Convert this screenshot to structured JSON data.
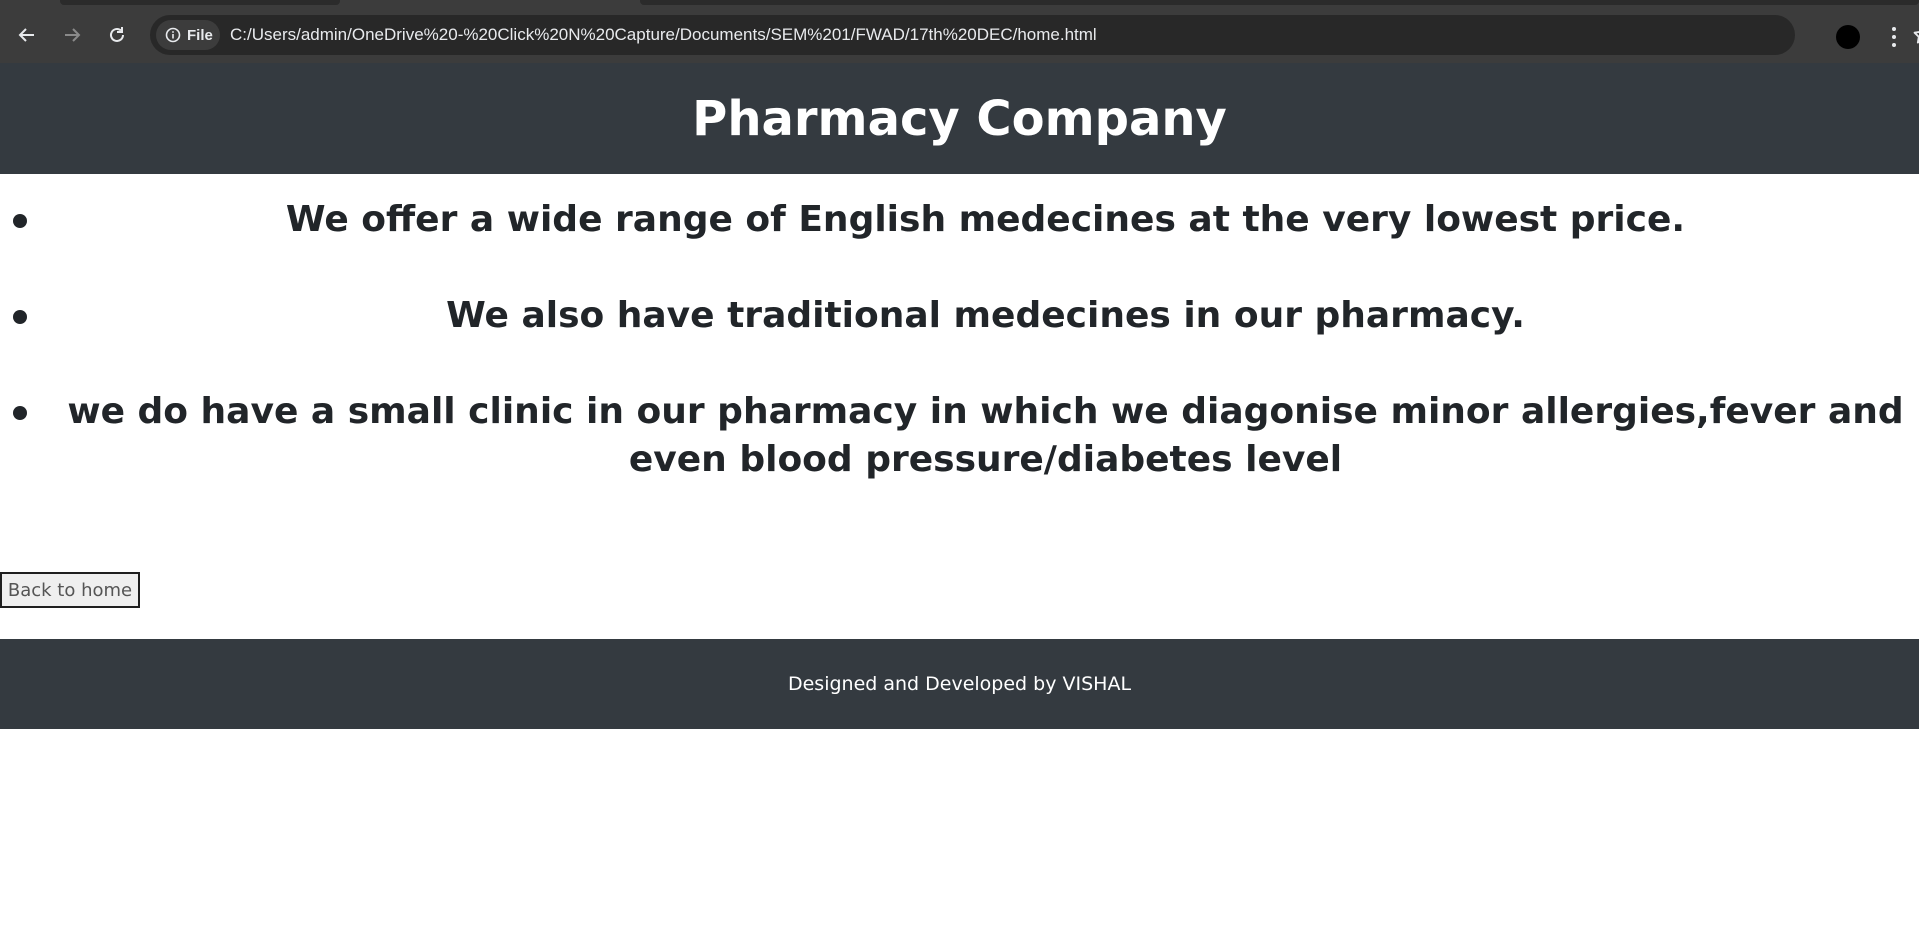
{
  "browser": {
    "site_chip_label": "File",
    "url": "C:/Users/admin/OneDrive%20-%20Click%20N%20Capture/Documents/SEM%201/FWAD/17th%20DEC/home.html",
    "icons": [
      "back-arrow-icon",
      "forward-arrow-icon",
      "reload-icon",
      "info-icon",
      "star-icon",
      "profile-avatar",
      "kebab-menu-icon"
    ]
  },
  "header": {
    "title": "Pharmacy Company"
  },
  "features": {
    "items": [
      {
        "text": "We offer a wide range of English medecines at the very lowest price."
      },
      {
        "text": "We also have traditional medecines in our pharmacy."
      },
      {
        "text": "we do have a small clinic in our pharmacy in which we diagonise minor allergies,fever and even blood pressure/diabetes level"
      }
    ]
  },
  "actions": {
    "back_label": "Back to home"
  },
  "footer": {
    "credit": "Designed and Developed by VISHAL"
  },
  "colors": {
    "header_bg": "#343a40",
    "footer_bg": "#343a40",
    "chrome_bg": "#3c3c3c",
    "text_dark": "#212529"
  }
}
